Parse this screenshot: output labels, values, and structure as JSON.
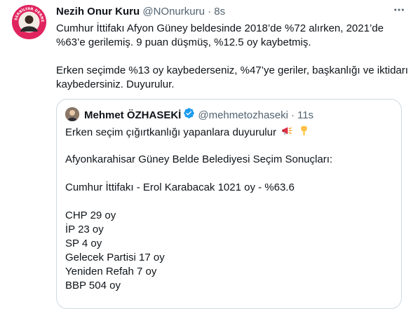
{
  "tweet": {
    "author_name": "Nezih Onur Kuru",
    "handle": "@NOnurkuru",
    "separator": "·",
    "time": "8s",
    "avatar_ring_text": "SERBİLYAR DERNEĞİ",
    "paragraphs": [
      "Cumhur İttifakı Afyon Güney beldesinde 2018’de %72 alırken, 2021’de %63’e gerilemiş. 9 puan düşmüş, %12.5 oy kaybetmiş.",
      "Erken seçimde %13 oy kaybederseniz, %47’ye geriler, başkanlığı ve iktidarı kaybedersiniz. Duyurulur."
    ]
  },
  "quoted_tweet": {
    "author_name": "Mehmet ÖZHASEKİ",
    "handle": "@mehmetozhaseki",
    "separator": "·",
    "time": "11s",
    "line1": "Erken seçim çığırtkanlığı yapanlara duyurulur",
    "line2": "Afyonkarahisar Güney Belde Belediyesi Seçim Sonuçları:",
    "line3": "Cumhur İttifakı - Erol Karabacak 1021 oy - %63.6",
    "results": [
      "CHP 29 oy",
      "İP 23 oy",
      "SP 4 oy",
      "Gelecek Partisi 17 oy",
      "Yeniden Refah 7 oy",
      "BBP 504 oy"
    ]
  },
  "icons": {
    "more": "more-horizontal-icon",
    "verified": "verified-badge-icon",
    "megaphone": "megaphone-emoji",
    "pointing_down": "backhand-index-pointing-down-emoji"
  },
  "colors": {
    "text": "#0f1419",
    "secondary": "#536471",
    "verified": "#1d9bf0",
    "border": "#cfd9de",
    "avatar_brand": "#e0245e"
  }
}
